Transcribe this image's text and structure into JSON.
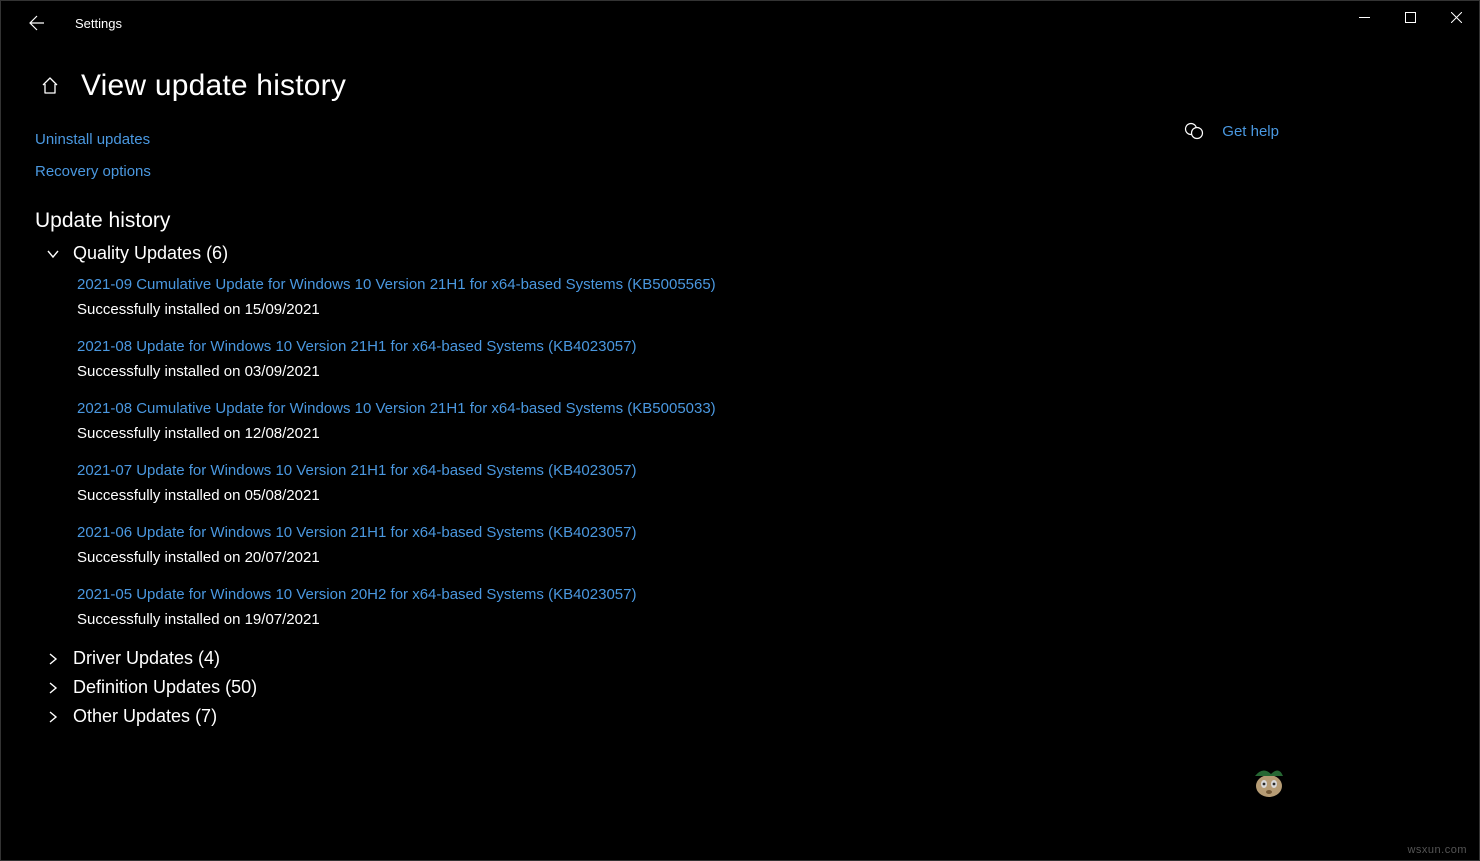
{
  "window": {
    "app_name": "Settings",
    "page_title": "View update history"
  },
  "actions": {
    "uninstall": "Uninstall updates",
    "recovery": "Recovery options",
    "get_help": "Get help"
  },
  "section_header": "Update history",
  "groups": {
    "quality": {
      "label": "Quality Updates (6)",
      "expanded": true
    },
    "driver": {
      "label": "Driver Updates (4)",
      "expanded": false
    },
    "definition": {
      "label": "Definition Updates (50)",
      "expanded": false
    },
    "other": {
      "label": "Other Updates (7)",
      "expanded": false
    }
  },
  "quality_updates": [
    {
      "title": "2021-09 Cumulative Update for Windows 10 Version 21H1 for x64-based Systems (KB5005565)",
      "status": "Successfully installed on 15/09/2021"
    },
    {
      "title": "2021-08 Update for Windows 10 Version 21H1 for x64-based Systems (KB4023057)",
      "status": "Successfully installed on 03/09/2021"
    },
    {
      "title": "2021-08 Cumulative Update for Windows 10 Version 21H1 for x64-based Systems (KB5005033)",
      "status": "Successfully installed on 12/08/2021"
    },
    {
      "title": "2021-07 Update for Windows 10 Version 21H1 for x64-based Systems (KB4023057)",
      "status": "Successfully installed on 05/08/2021"
    },
    {
      "title": "2021-06 Update for Windows 10 Version 21H1 for x64-based Systems (KB4023057)",
      "status": "Successfully installed on 20/07/2021"
    },
    {
      "title": "2021-05 Update for Windows 10 Version 20H2 for x64-based Systems (KB4023057)",
      "status": "Successfully installed on 19/07/2021"
    }
  ],
  "watermark": "wsxun.com"
}
